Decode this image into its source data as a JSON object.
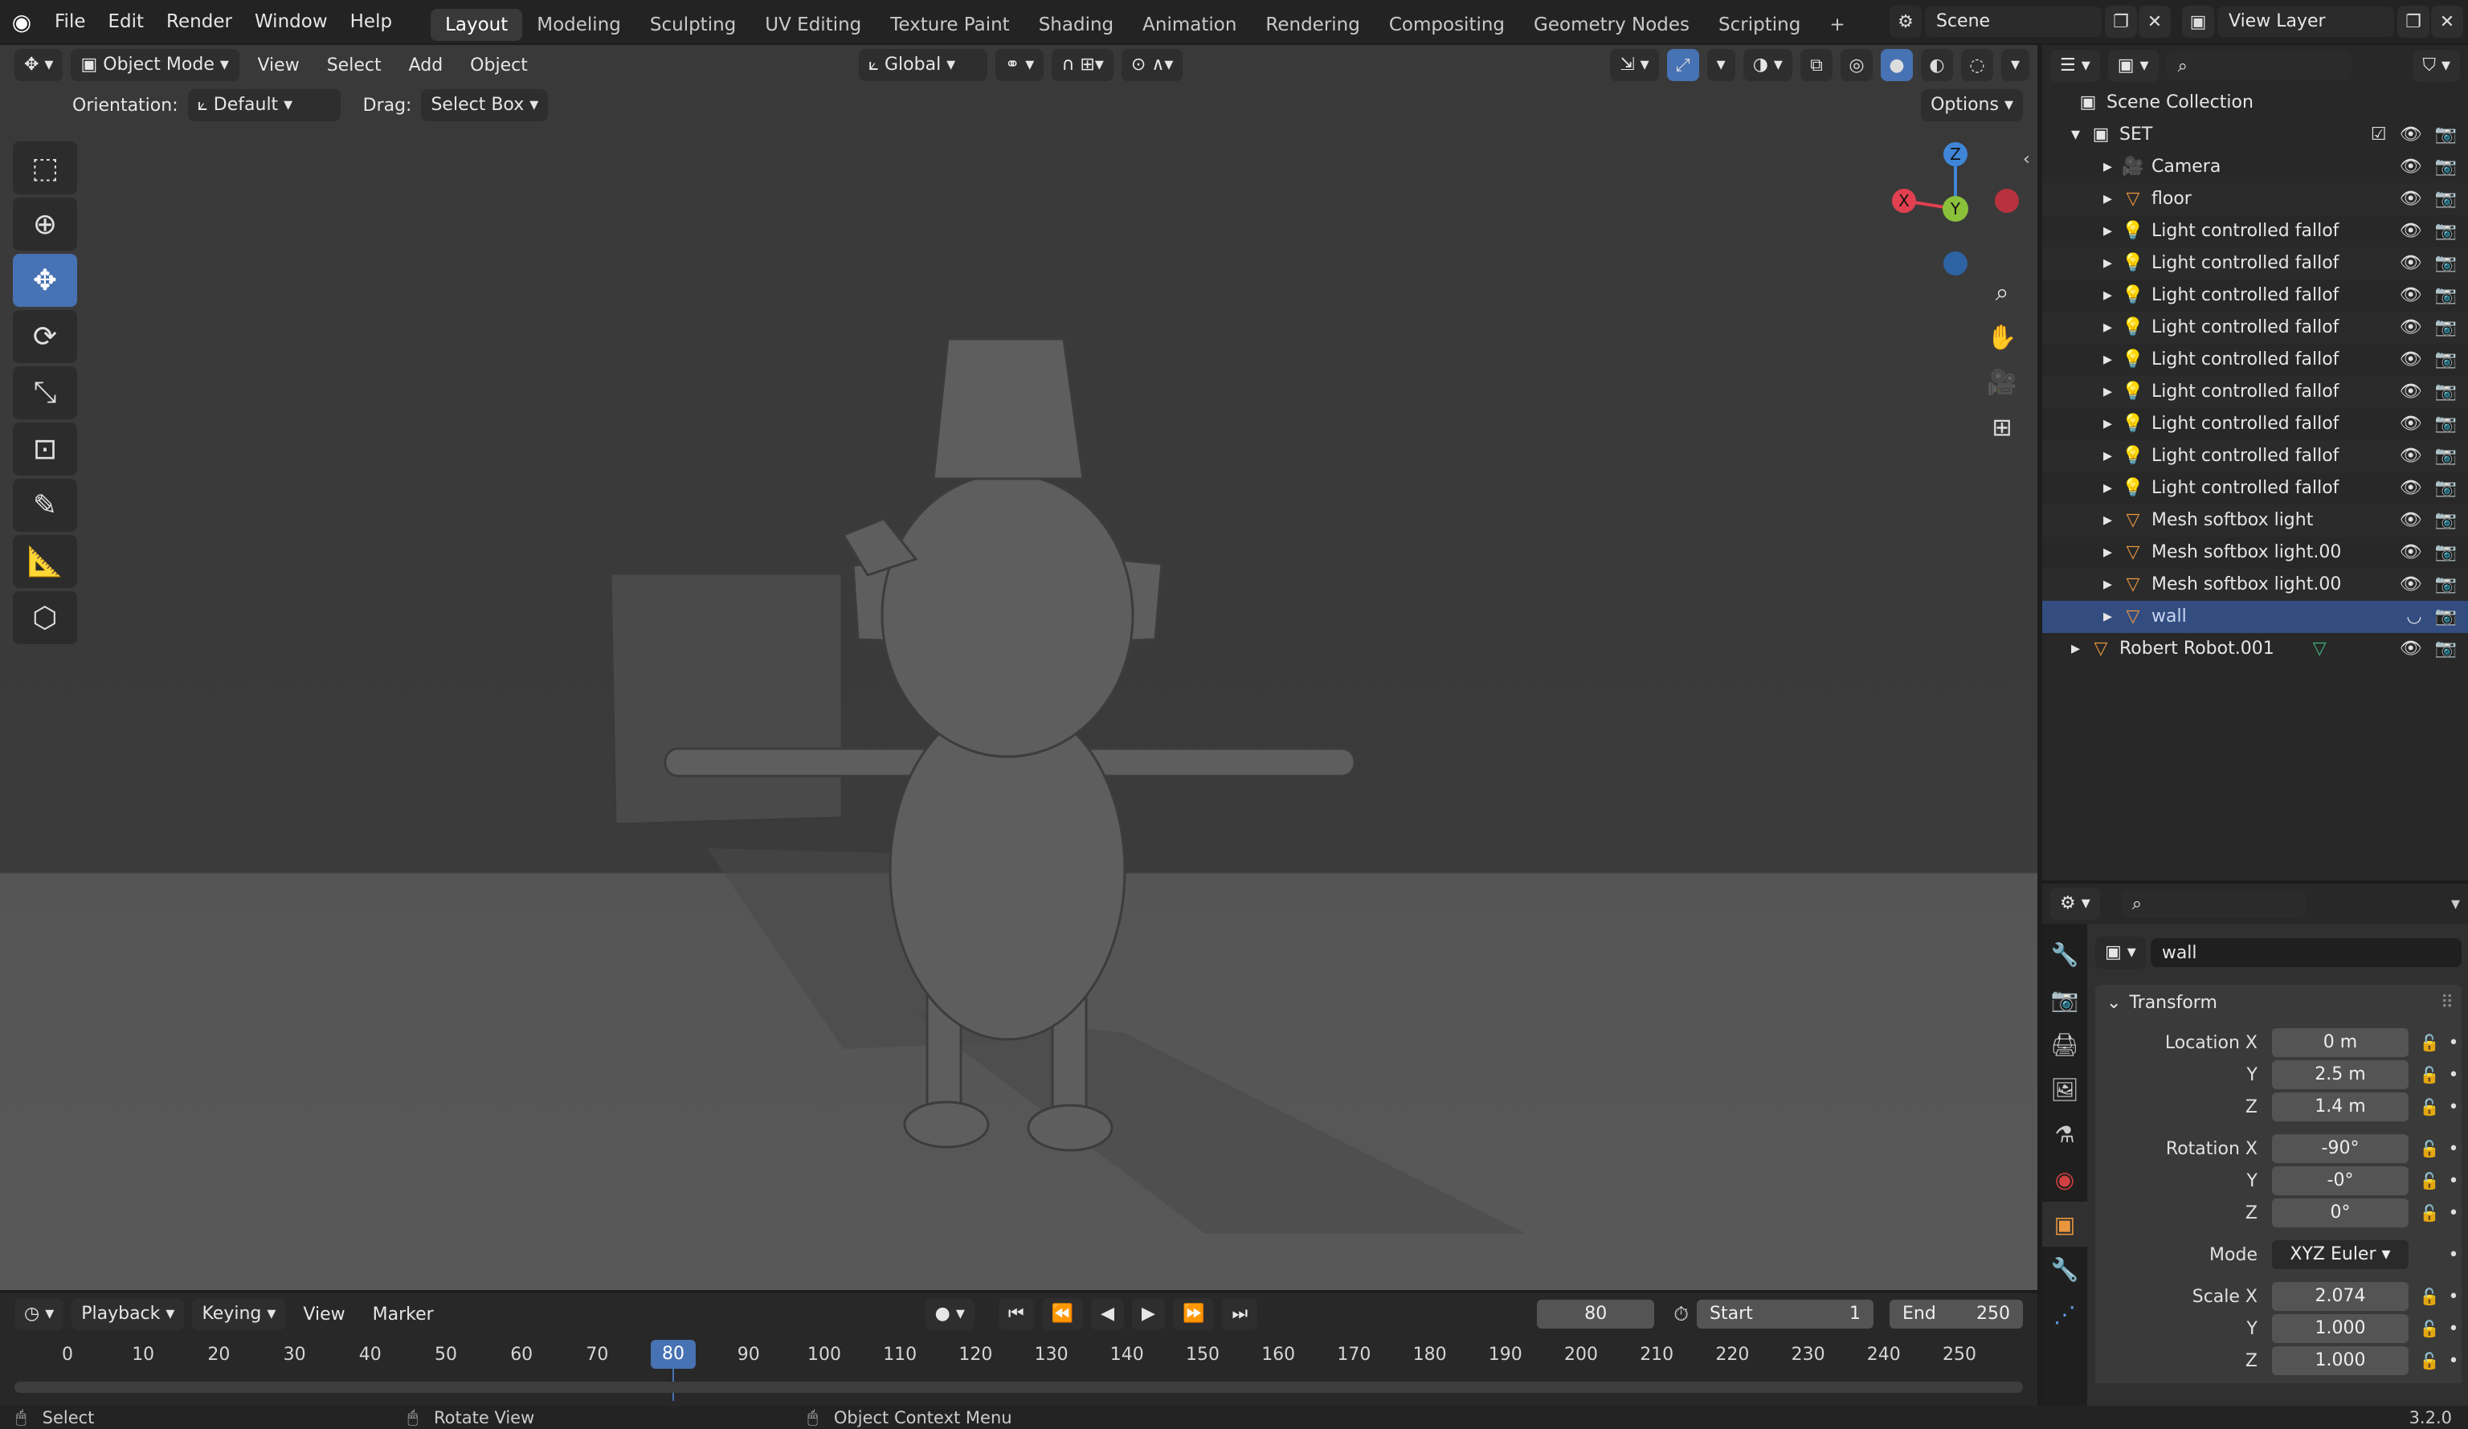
{
  "app": {
    "version": "3.2.0"
  },
  "topbar": {
    "menus": [
      "File",
      "Edit",
      "Render",
      "Window",
      "Help"
    ],
    "workspaces": [
      "Layout",
      "Modeling",
      "Sculpting",
      "UV Editing",
      "Texture Paint",
      "Shading",
      "Animation",
      "Rendering",
      "Compositing",
      "Geometry Nodes",
      "Scripting"
    ],
    "active_workspace": "Layout",
    "add_tab": "+",
    "scene": "Scene",
    "view_layer": "View Layer"
  },
  "viewport": {
    "header": {
      "mode": "Object Mode",
      "menus": [
        "View",
        "Select",
        "Add",
        "Object"
      ],
      "transform_orientation": "Global"
    },
    "header2": {
      "orientation_label": "Orientation:",
      "orientation_value": "Default",
      "drag_label": "Drag:",
      "drag_value": "Select Box",
      "options": "Options"
    },
    "gizmo": {
      "z": "Z",
      "y": "Y",
      "x": "X"
    },
    "colors": {
      "x": "#e04050",
      "y": "#8ac03a",
      "z": "#3f86d8"
    }
  },
  "outliner": {
    "root": "Scene Collection",
    "collection": "SET",
    "items": [
      {
        "name": "Camera",
        "icon": "camera-icon"
      },
      {
        "name": "floor",
        "icon": "mesh-icon"
      },
      {
        "name": "Light controlled fallof",
        "icon": "light-icon"
      },
      {
        "name": "Light controlled fallof",
        "icon": "light-icon"
      },
      {
        "name": "Light controlled fallof",
        "icon": "light-icon"
      },
      {
        "name": "Light controlled fallof",
        "icon": "light-icon"
      },
      {
        "name": "Light controlled fallof",
        "icon": "light-icon"
      },
      {
        "name": "Light controlled fallof",
        "icon": "light-icon"
      },
      {
        "name": "Light controlled fallof",
        "icon": "light-icon"
      },
      {
        "name": "Light controlled fallof",
        "icon": "light-icon"
      },
      {
        "name": "Light controlled fallof",
        "icon": "light-icon"
      },
      {
        "name": "Mesh softbox light",
        "icon": "mesh-icon"
      },
      {
        "name": "Mesh softbox light.00",
        "icon": "mesh-icon"
      },
      {
        "name": "Mesh softbox light.00",
        "icon": "mesh-icon"
      },
      {
        "name": "wall",
        "icon": "mesh-icon",
        "selected": true
      }
    ],
    "robot": "Robert Robot.001"
  },
  "properties": {
    "object_name": "wall",
    "panel": "Transform",
    "location_label": "Location X",
    "location": [
      "0 m",
      "2.5 m",
      "1.4 m"
    ],
    "rotation_label": "Rotation X",
    "rotation": [
      "-90°",
      "-0°",
      "0°"
    ],
    "mode_label": "Mode",
    "mode_value": "XYZ Euler",
    "scale_label": "Scale X",
    "scale": [
      "2.074",
      "1.000",
      "1.000"
    ],
    "axis_y": "Y",
    "axis_z": "Z"
  },
  "timeline": {
    "menus": [
      "Playback",
      "Keying",
      "View",
      "Marker"
    ],
    "current_frame": "80",
    "start_label": "Start",
    "start": "1",
    "end_label": "End",
    "end": "250",
    "ticks": [
      "0",
      "10",
      "20",
      "30",
      "40",
      "50",
      "60",
      "70",
      "80",
      "90",
      "100",
      "110",
      "120",
      "130",
      "140",
      "150",
      "160",
      "170",
      "180",
      "190",
      "200",
      "210",
      "220",
      "230",
      "240",
      "250"
    ]
  },
  "statusbar": {
    "select": "Select",
    "rotate": "Rotate View",
    "context": "Object Context Menu",
    "version": "3.2.0"
  }
}
